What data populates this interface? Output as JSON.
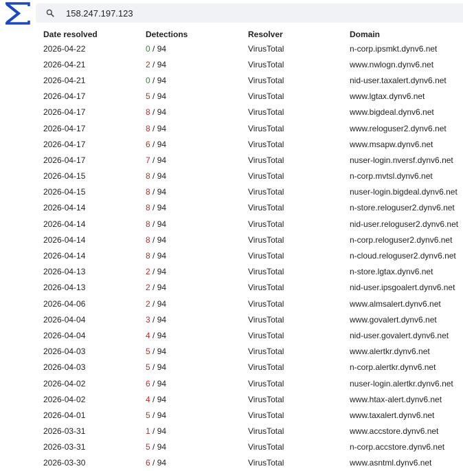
{
  "search": {
    "value": "158.247.197.123"
  },
  "colors": {
    "accent": "#1a47c8",
    "detections_zero": "#2e8b2e",
    "detections_positive": "#c62828"
  },
  "table": {
    "headers": [
      "Date resolved",
      "Detections",
      "Resolver",
      "Domain"
    ],
    "rows": [
      {
        "date": "2026-04-22",
        "detections": "0",
        "total": " / 94",
        "resolver": "VirusTotal",
        "domain": "n-corp.ipsmkt.dynv6.net"
      },
      {
        "date": "2026-04-21",
        "detections": "2",
        "total": " / 94",
        "resolver": "VirusTotal",
        "domain": "www.nwlogn.dynv6.net"
      },
      {
        "date": "2026-04-21",
        "detections": "0",
        "total": " / 94",
        "resolver": "VirusTotal",
        "domain": "nid-user.taxalert.dynv6.net"
      },
      {
        "date": "2026-04-17",
        "detections": "5",
        "total": " / 94",
        "resolver": "VirusTotal",
        "domain": "www.lgtax.dynv6.net"
      },
      {
        "date": "2026-04-17",
        "detections": "8",
        "total": " / 94",
        "resolver": "VirusTotal",
        "domain": "www.bigdeal.dynv6.net"
      },
      {
        "date": "2026-04-17",
        "detections": "8",
        "total": " / 94",
        "resolver": "VirusTotal",
        "domain": "www.reloguser2.dynv6.net"
      },
      {
        "date": "2026-04-17",
        "detections": "6",
        "total": " / 94",
        "resolver": "VirusTotal",
        "domain": "www.msapw.dynv6.net"
      },
      {
        "date": "2026-04-17",
        "detections": "7",
        "total": " / 94",
        "resolver": "VirusTotal",
        "domain": "nuser-login.nversf.dynv6.net"
      },
      {
        "date": "2026-04-15",
        "detections": "8",
        "total": " / 94",
        "resolver": "VirusTotal",
        "domain": "n-corp.mvtsl.dynv6.net"
      },
      {
        "date": "2026-04-15",
        "detections": "8",
        "total": " / 94",
        "resolver": "VirusTotal",
        "domain": "nuser-login.bigdeal.dynv6.net"
      },
      {
        "date": "2026-04-14",
        "detections": "8",
        "total": " / 94",
        "resolver": "VirusTotal",
        "domain": "n-store.reloguser2.dynv6.net"
      },
      {
        "date": "2026-04-14",
        "detections": "8",
        "total": " / 94",
        "resolver": "VirusTotal",
        "domain": "nid-user.reloguser2.dynv6.net"
      },
      {
        "date": "2026-04-14",
        "detections": "8",
        "total": " / 94",
        "resolver": "VirusTotal",
        "domain": "n-corp.reloguser2.dynv6.net"
      },
      {
        "date": "2026-04-14",
        "detections": "8",
        "total": " / 94",
        "resolver": "VirusTotal",
        "domain": "n-cloud.reloguser2.dynv6.net"
      },
      {
        "date": "2026-04-13",
        "detections": "2",
        "total": " / 94",
        "resolver": "VirusTotal",
        "domain": "n-store.lgtax.dynv6.net"
      },
      {
        "date": "2026-04-13",
        "detections": "2",
        "total": " / 94",
        "resolver": "VirusTotal",
        "domain": "nid-user.ipsgoalert.dynv6.net"
      },
      {
        "date": "2026-04-06",
        "detections": "2",
        "total": " / 94",
        "resolver": "VirusTotal",
        "domain": "www.almsalert.dynv6.net"
      },
      {
        "date": "2026-04-04",
        "detections": "3",
        "total": " / 94",
        "resolver": "VirusTotal",
        "domain": "www.govalert.dynv6.net"
      },
      {
        "date": "2026-04-04",
        "detections": "4",
        "total": " / 94",
        "resolver": "VirusTotal",
        "domain": "nid-user.govalert.dynv6.net"
      },
      {
        "date": "2026-04-03",
        "detections": "5",
        "total": " / 94",
        "resolver": "VirusTotal",
        "domain": "www.alertkr.dynv6.net"
      },
      {
        "date": "2026-04-03",
        "detections": "5",
        "total": " / 94",
        "resolver": "VirusTotal",
        "domain": "n-corp.alertkr.dynv6.net"
      },
      {
        "date": "2026-04-02",
        "detections": "6",
        "total": " / 94",
        "resolver": "VirusTotal",
        "domain": "nuser-login.alertkr.dynv6.net"
      },
      {
        "date": "2026-04-02",
        "detections": "4",
        "total": " / 94",
        "resolver": "VirusTotal",
        "domain": "www.htax-alert.dynv6.net"
      },
      {
        "date": "2026-04-01",
        "detections": "5",
        "total": " / 94",
        "resolver": "VirusTotal",
        "domain": "www.taxalert.dynv6.net"
      },
      {
        "date": "2026-03-31",
        "detections": "1",
        "total": " / 94",
        "resolver": "VirusTotal",
        "domain": "www.accstore.dynv6.net"
      },
      {
        "date": "2026-03-31",
        "detections": "5",
        "total": " / 94",
        "resolver": "VirusTotal",
        "domain": "n-corp.accstore.dynv6.net"
      },
      {
        "date": "2026-03-30",
        "detections": "6",
        "total": " / 94",
        "resolver": "VirusTotal",
        "domain": "www.asntml.dynv6.net"
      }
    ]
  }
}
